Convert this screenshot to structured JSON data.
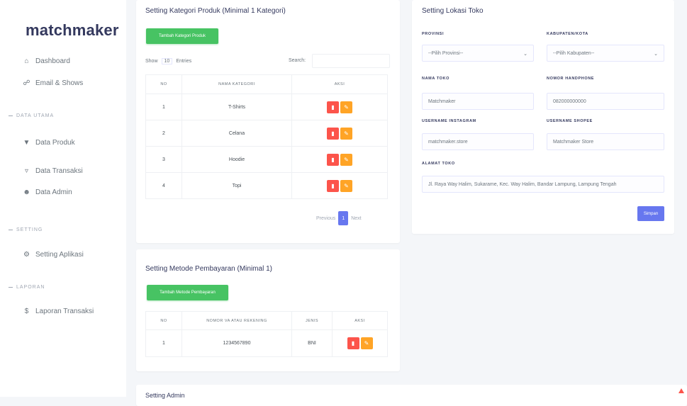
{
  "app": {
    "brand": "matchmaker"
  },
  "sidebar": {
    "items": [
      {
        "label": "Dashboard",
        "icon": "home-icon"
      },
      {
        "label": "Email & Shows",
        "icon": "link-icon"
      }
    ],
    "headers": [
      "DATA UTAMA",
      "SETTING",
      "LAPORAN"
    ],
    "data_items": [
      {
        "label": "Data Produk",
        "icon": "funnel-icon"
      },
      {
        "label": "Data Transaksi",
        "icon": "filter-icon"
      },
      {
        "label": "Data Admin",
        "icon": "users-icon"
      }
    ],
    "setting_items": [
      {
        "label": "Setting Aplikasi",
        "icon": "gear-icon"
      }
    ],
    "laporan_items": [
      {
        "label": "Laporan Transaksi",
        "icon": "dollar-icon"
      }
    ]
  },
  "kategori": {
    "title": "Setting Kategori Produk (Minimal 1 Kategori)",
    "add_button": "Tambah Kategori Produk",
    "show_label": "Show",
    "show_value": "10",
    "entries_label": "Entries",
    "search_label": "Search:",
    "columns": [
      "NO",
      "NAMA KATEGORI",
      "AKSI"
    ],
    "rows": [
      {
        "no": "1",
        "name": "T-Shirts"
      },
      {
        "no": "2",
        "name": "Celana"
      },
      {
        "no": "3",
        "name": "Hoodie"
      },
      {
        "no": "4",
        "name": "Topi"
      }
    ],
    "pagination": {
      "prev": "Previous",
      "page": "1",
      "next": "Next"
    }
  },
  "lokasi": {
    "title": "Setting Lokasi Toko",
    "provinsi_label": "PROVINSI",
    "provinsi_value": "--Pilih Provinsi--",
    "kabupaten_label": "KABUPATEN/KOTA",
    "kabupaten_value": "--Pilih Kabupaten--",
    "nama_toko_label": "NAMA TOKO",
    "nama_toko_value": "Matchmaker",
    "nomor_label": "NOMOR HANDPHONE",
    "nomor_value": "082000000000",
    "username_ig_label": "USERNAME INSTAGRAM",
    "username_ig_value": "matchmaker.store",
    "username_shopee_label": "USERNAME SHOPEE",
    "username_shopee_value": "Matchmaker Store",
    "alamat_label": "ALAMAT TOKO",
    "alamat_value": "Jl. Raya Way Halim, Sukarame, Kec. Way Halim, Bandar Lampung, Lampung Tengah",
    "save_button": "Simpan"
  },
  "pembayaran": {
    "title": "Setting Metode Pembayaran (Minimal 1)",
    "add_button": "Tambah Metode Pembayaran",
    "columns": [
      "NO",
      "NOMOR VA ATAU REKENING",
      "JENIS",
      "AKSI"
    ],
    "rows": [
      {
        "no": "1",
        "rekening": "1234567890",
        "jenis": "BNI"
      }
    ]
  },
  "bottom_card": {
    "title": "Setting Admin"
  },
  "colors": {
    "primary": "#6777ef",
    "success": "#47c363",
    "danger": "#fc544b",
    "warning": "#ffa426"
  }
}
